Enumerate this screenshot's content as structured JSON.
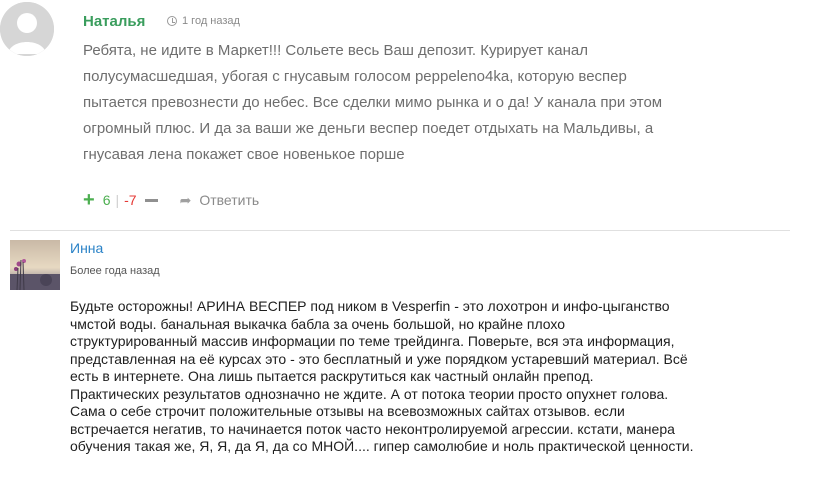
{
  "comment1": {
    "author": "Наталья",
    "time": "1 год назад",
    "text_lines": [
      "Ребята, не идите в Маркет!!! Сольете весь Ваш депозит. Курирует канал",
      "полусумасшедшая, убогая с гнусавым голосом peppeleno4ka, которую веспер",
      "пытается превознести до небес. Все сделки мимо рынка и о да! У канала при этом",
      "огромный плюс. И да за ваши же деньги веспер поедет отдыхать на Мальдивы, а",
      "гнусавая лена покажет свое новенькое порше"
    ],
    "votes_up": "6",
    "separator": "|",
    "votes_down": "-7",
    "reply_label": "Ответить"
  },
  "comment2": {
    "author": "Инна",
    "time": "Более года назад",
    "text_lines": [
      "Будьте осторожны! АРИНА ВЕСПЕР под ником в Vesperfin - это лохотрон и инфо-цыганство",
      "чмстой воды. банальная выкачка бабла за очень большой, но крайне плохо",
      "структурированный массив информации по теме трейдинга. Поверьте, вся эта информация,",
      "представленная на её курсах это - это бесплатный и уже порядком устаревший материал. Всё",
      "есть в интернете. Она лишь пытается раскрутиться как частный онлайн препод.",
      "Практических результатов однозначно не ждите. А от потока теории просто опухнет голова.",
      "Сама о себе строчит положительные отзывы на всевозможных сайтах отзывов. если",
      "встречается негатив, то начинается поток часто неконтролируемой агрессии. кстати, манера",
      "обучения такая же, Я, Я, да Я, да со МНОЙ.... гипер самолюбие и ноль практической ценности."
    ]
  },
  "colors": {
    "author_green": "#3a9d5d",
    "vote_up_green": "#4caf50",
    "vote_down_red": "#e53935",
    "author_blue": "#2a82c7"
  },
  "icons": [
    "default-avatar-icon",
    "clock-icon",
    "plus-icon",
    "minus-icon",
    "reply-arrow-icon"
  ]
}
